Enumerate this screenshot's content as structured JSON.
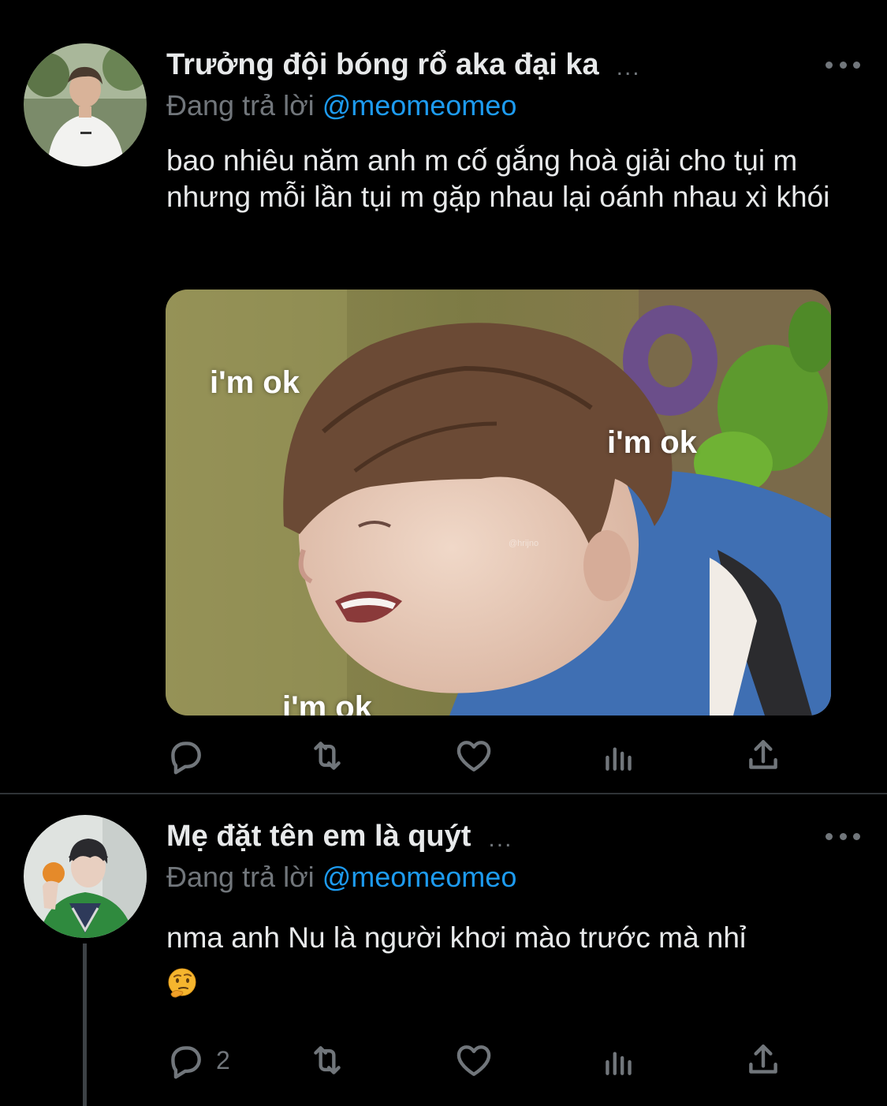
{
  "tweets": [
    {
      "author": {
        "display_name": "Trưởng đội bóng rổ aka đại ka",
        "name_ellipsis": "...",
        "avatar_icon": "profile-photo-avatar"
      },
      "reply_to": {
        "prefix": "Đang trả lời",
        "handle": "@meomeomeo"
      },
      "text": "bao nhiêu năm anh m cố gắng hoà giải cho tụi m nhưng mỗi lần tụi m gặp nhau lại oánh nhau xì khói",
      "media": {
        "captions": [
          "i'm ok",
          "i'm ok",
          "i'm ok"
        ],
        "watermark": "@hrijno"
      },
      "actions": {
        "reply_count": "",
        "retweet_count": "",
        "like_count": ""
      }
    },
    {
      "author": {
        "display_name": "Mẹ đặt tên em là quýt",
        "name_ellipsis": "...",
        "avatar_icon": "profile-photo-avatar"
      },
      "reply_to": {
        "prefix": "Đang trả lời",
        "handle": "@meomeomeo"
      },
      "text": "nma anh Nu là người khơi mào trước mà nhỉ",
      "emoji": "🤔",
      "actions": {
        "reply_count": "2",
        "retweet_count": "",
        "like_count": ""
      }
    }
  ],
  "colors": {
    "background": "#000000",
    "text_primary": "#e7e9ea",
    "text_secondary": "#71767b",
    "link": "#1d9bf0",
    "divider": "#2f3336"
  },
  "icons": [
    "reply-icon",
    "retweet-icon",
    "like-icon",
    "views-icon",
    "share-icon",
    "more-icon"
  ]
}
